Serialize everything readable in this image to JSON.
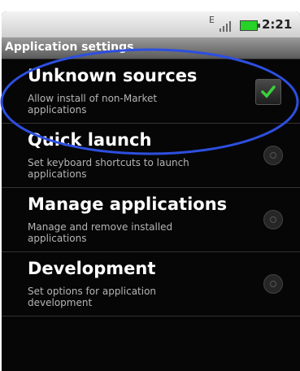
{
  "status_bar": {
    "network": "E",
    "time": "2:21"
  },
  "header": {
    "title": "Application settings"
  },
  "items": [
    {
      "label": "Unknown sources",
      "summary": "Allow install of non-Market applications",
      "checked": true
    },
    {
      "label": "Quick launch",
      "summary": "Set keyboard shortcuts to launch applications"
    },
    {
      "label": "Manage applications",
      "summary": "Manage and remove installed applications"
    },
    {
      "label": "Development",
      "summary": "Set options for application development"
    }
  ],
  "colors": {
    "annotation": "#2d4fe0",
    "check": "#3ad13a"
  }
}
